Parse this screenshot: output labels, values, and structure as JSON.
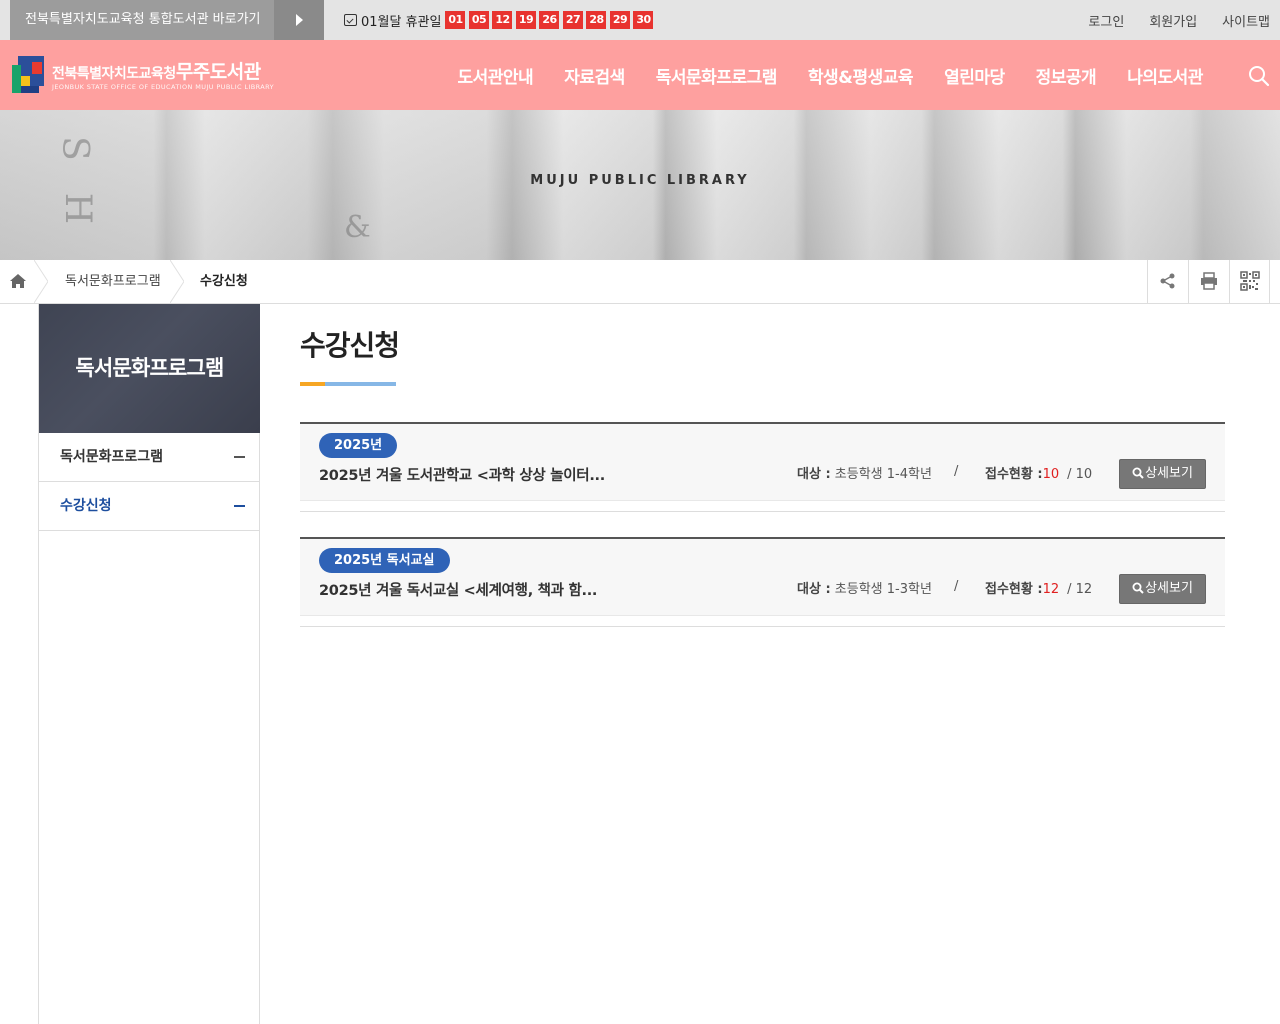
{
  "topbar": {
    "shortcut_label": "전북특별자치도교육청 통합도서관 바로가기",
    "closed_label": "01월달 휴관일",
    "closed_days": [
      "01",
      "05",
      "12",
      "19",
      "26",
      "27",
      "28",
      "29",
      "30"
    ],
    "links": {
      "login": "로그인",
      "join": "회원가입",
      "sitemap": "사이트맵"
    }
  },
  "header": {
    "org_prefix": "전북특별자치도교육청",
    "library_name": "무주도서관",
    "english_name": "JEONBUK STATE OFFICE OF EDUCATION MUJU PUBLIC LIBRARY",
    "menu": [
      "도서관안내",
      "자료검색",
      "독서문화프로그램",
      "학생&평생교육",
      "열린마당",
      "정보공개",
      "나의도서관"
    ]
  },
  "visual": {
    "title": "MUJU PUBLIC LIBRARY"
  },
  "breadcrumb": [
    "독서문화프로그램",
    "수강신청"
  ],
  "sidebar": {
    "title": "독서문화프로그램",
    "items": [
      {
        "label": "독서문화프로그램",
        "active": false
      },
      {
        "label": "수강신청",
        "active": true
      }
    ]
  },
  "content": {
    "title": "수강신청",
    "programs": [
      {
        "badge": "2025년",
        "title": "2025년 겨울 도서관학교 <과학 상상 놀이터...",
        "target_label": "대상 :",
        "target_value": "초등학생 1-4학년",
        "separator": "/",
        "status_label": "접수현황 :",
        "status_count": "10",
        "status_total": "/ 10",
        "button": "상세보기"
      },
      {
        "badge": "2025년 독서교실",
        "title": "2025년 겨울 독서교실 <세계여행, 책과 함...",
        "target_label": "대상 :",
        "target_value": "초등학생 1-3학년",
        "separator": "/",
        "status_label": "접수현황 :",
        "status_count": "12",
        "status_total": "/ 12",
        "button": "상세보기"
      }
    ]
  },
  "colors": {
    "header_bg": "#fea09f",
    "closed_day_bg": "#e8332f",
    "badge_bg": "#2f63b7",
    "active_menu": "#1d4e9e",
    "accent_orange": "#f6a624",
    "accent_blue": "#86b7e6"
  },
  "icons": [
    "arrow-right-icon",
    "calendar-check-icon",
    "logo-mark-icon",
    "search-icon",
    "home-icon",
    "share-icon",
    "print-icon",
    "qr-code-icon",
    "minus-icon",
    "magnifier-icon"
  ]
}
